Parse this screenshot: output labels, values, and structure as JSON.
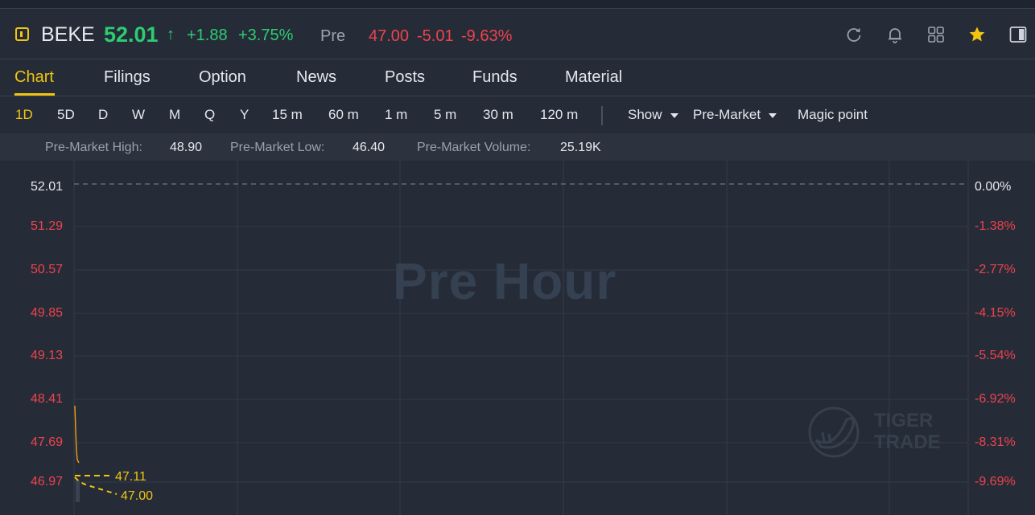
{
  "header": {
    "symbol": "BEKE",
    "price": "52.01",
    "price_arrow": "↑",
    "change": "+1.88",
    "change_pct": "+3.75%",
    "pre_label": "Pre",
    "pre_price": "47.00",
    "pre_change": "-5.01",
    "pre_change_pct": "-9.63%",
    "icons": [
      "refresh-icon",
      "bell-icon",
      "grid-icon",
      "star-icon",
      "panel-toggle-icon"
    ]
  },
  "tabs": [
    "Chart",
    "Filings",
    "Option",
    "News",
    "Posts",
    "Funds",
    "Material"
  ],
  "active_tab": "Chart",
  "toolbar": {
    "periods": [
      "1D",
      "5D",
      "D",
      "W",
      "M",
      "Q",
      "Y",
      "15 m",
      "60 m",
      "1 m",
      "5 m",
      "30 m",
      "120 m"
    ],
    "active_period": "1D",
    "show_label": "Show",
    "session_label": "Pre-Market",
    "magic_label": "Magic point"
  },
  "stats": {
    "high_label": "Pre-Market High:",
    "high_value": "48.90",
    "low_label": "Pre-Market Low:",
    "low_value": "46.40",
    "volume_label": "Pre-Market Volume:",
    "volume_value": "25.19K"
  },
  "chart": {
    "watermark": "Pre Hour",
    "brand_line1": "TIGER",
    "brand_line2": "TRADE",
    "y_left": [
      "52.01",
      "51.29",
      "50.57",
      "49.85",
      "49.13",
      "48.41",
      "47.69",
      "46.97"
    ],
    "y_right": [
      "0.00%",
      "-1.38%",
      "-2.77%",
      "-4.15%",
      "-5.54%",
      "-6.92%",
      "-8.31%",
      "-9.69%"
    ],
    "marker_1": "47.11",
    "marker_2": "47.00",
    "colors": {
      "positive": "#2ecc71",
      "negative": "#f0424c",
      "accent": "#f1c40f",
      "price_line": "#f39c12"
    }
  }
}
